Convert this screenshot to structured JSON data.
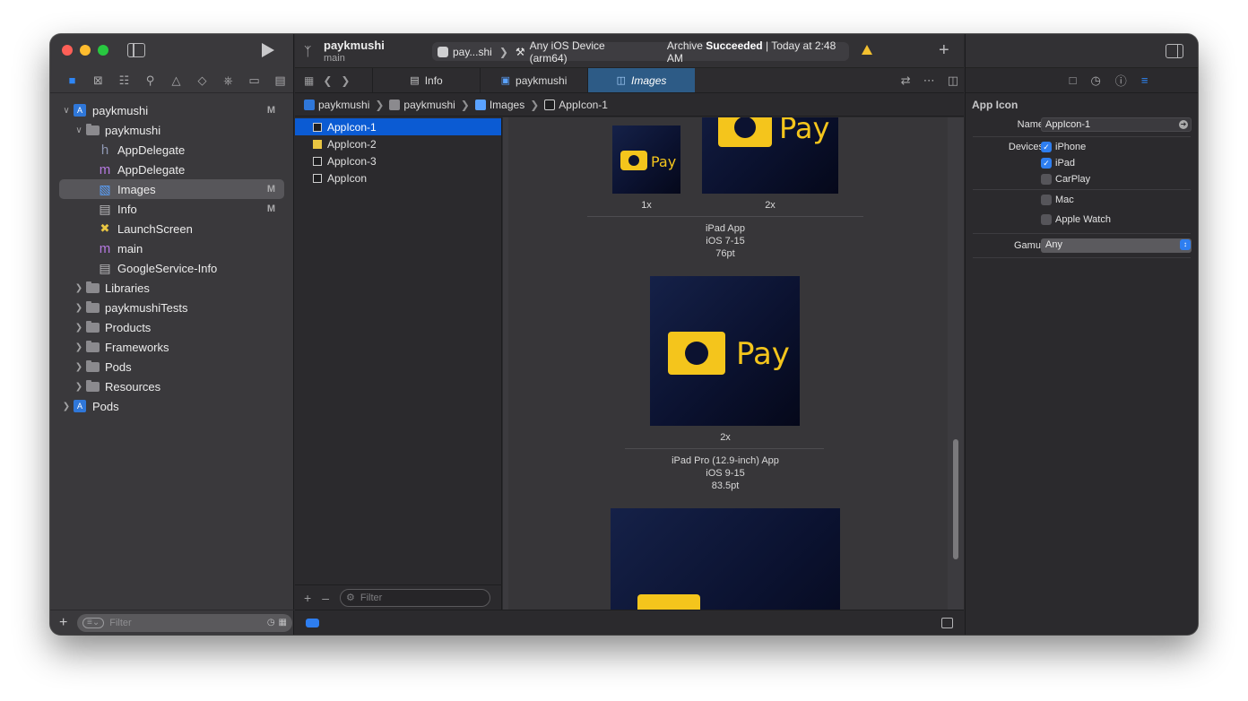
{
  "navigator": {
    "items": [
      {
        "label": "paykmushi",
        "badge": "M",
        "kind": "project",
        "depth": 0,
        "chevron": "open"
      },
      {
        "label": "paykmushi",
        "badge": "",
        "kind": "folder",
        "depth": 1,
        "chevron": "open"
      },
      {
        "label": "AppDelegate",
        "badge": "",
        "kind": "h-file",
        "depth": 2,
        "chevron": ""
      },
      {
        "label": "AppDelegate",
        "badge": "",
        "kind": "m-file",
        "depth": 2,
        "chevron": ""
      },
      {
        "label": "Images",
        "badge": "M",
        "kind": "assets",
        "depth": 2,
        "chevron": "",
        "selected": true
      },
      {
        "label": "Info",
        "badge": "M",
        "kind": "plist",
        "depth": 2,
        "chevron": ""
      },
      {
        "label": "LaunchScreen",
        "badge": "",
        "kind": "storyboard",
        "depth": 2,
        "chevron": ""
      },
      {
        "label": "main",
        "badge": "",
        "kind": "m-file",
        "depth": 2,
        "chevron": ""
      },
      {
        "label": "GoogleService-Info",
        "badge": "",
        "kind": "plist",
        "depth": 2,
        "chevron": ""
      },
      {
        "label": "Libraries",
        "badge": "",
        "kind": "folder",
        "depth": 1,
        "chevron": "closed"
      },
      {
        "label": "paykmushiTests",
        "badge": "",
        "kind": "folder",
        "depth": 1,
        "chevron": "closed"
      },
      {
        "label": "Products",
        "badge": "",
        "kind": "folder",
        "depth": 1,
        "chevron": "closed"
      },
      {
        "label": "Frameworks",
        "badge": "",
        "kind": "folder",
        "depth": 1,
        "chevron": "closed"
      },
      {
        "label": "Pods",
        "badge": "",
        "kind": "folder",
        "depth": 1,
        "chevron": "closed"
      },
      {
        "label": "Resources",
        "badge": "",
        "kind": "folder",
        "depth": 1,
        "chevron": "closed"
      },
      {
        "label": "Pods",
        "badge": "",
        "kind": "project",
        "depth": 0,
        "chevron": "closed"
      }
    ],
    "filter_placeholder": "Filter"
  },
  "toolbar": {
    "project": "paykmushi",
    "branch": "main",
    "scheme": "pay...shi",
    "device": "Any iOS Device (arm64)",
    "status_prefix": "Archive",
    "status_bold": "Succeeded",
    "status_suffix": "| Today at 2:48 AM"
  },
  "tabs": [
    {
      "label": "Info",
      "active": false
    },
    {
      "label": "paykmushi",
      "active": false
    },
    {
      "label": "Images",
      "active": true
    }
  ],
  "breadcrumbs": [
    "paykmushi",
    "paykmushi",
    "Images",
    "AppIcon-1"
  ],
  "asset_sets": [
    {
      "label": "AppIcon-1",
      "selected": true
    },
    {
      "label": "AppIcon-2",
      "selected": false
    },
    {
      "label": "AppIcon-3",
      "selected": false
    },
    {
      "label": "AppIcon",
      "selected": false
    }
  ],
  "list_filter_placeholder": "Filter",
  "canvas": {
    "icon_text": "Pay",
    "top_scale_1": "1x",
    "top_scale_2": "2x",
    "group1": {
      "line1": "iPad App",
      "line2": "iOS 7-15",
      "line3": "76pt"
    },
    "mid_scale": "2x",
    "group2": {
      "line1": "iPad Pro (12.9-inch) App",
      "line2": "iOS 9-15",
      "line3": "83.5pt"
    }
  },
  "inspector": {
    "title": "App Icon",
    "name_label": "Name",
    "name_value": "AppIcon-1",
    "devices_label": "Devices",
    "devices": [
      {
        "label": "iPhone",
        "checked": true
      },
      {
        "label": "iPad",
        "checked": true
      },
      {
        "label": "CarPlay",
        "checked": false
      },
      {
        "label": "Mac",
        "checked": false
      },
      {
        "label": "Apple Watch",
        "checked": false
      }
    ],
    "gamut_label": "Gamut",
    "gamut_value": "Any"
  },
  "colors": {
    "accent": "#2e86f6",
    "selection": "#0b5bd3",
    "warning": "#f3c02f",
    "brand_yellow": "#f4c51c",
    "icon_background": "#0b1230"
  }
}
